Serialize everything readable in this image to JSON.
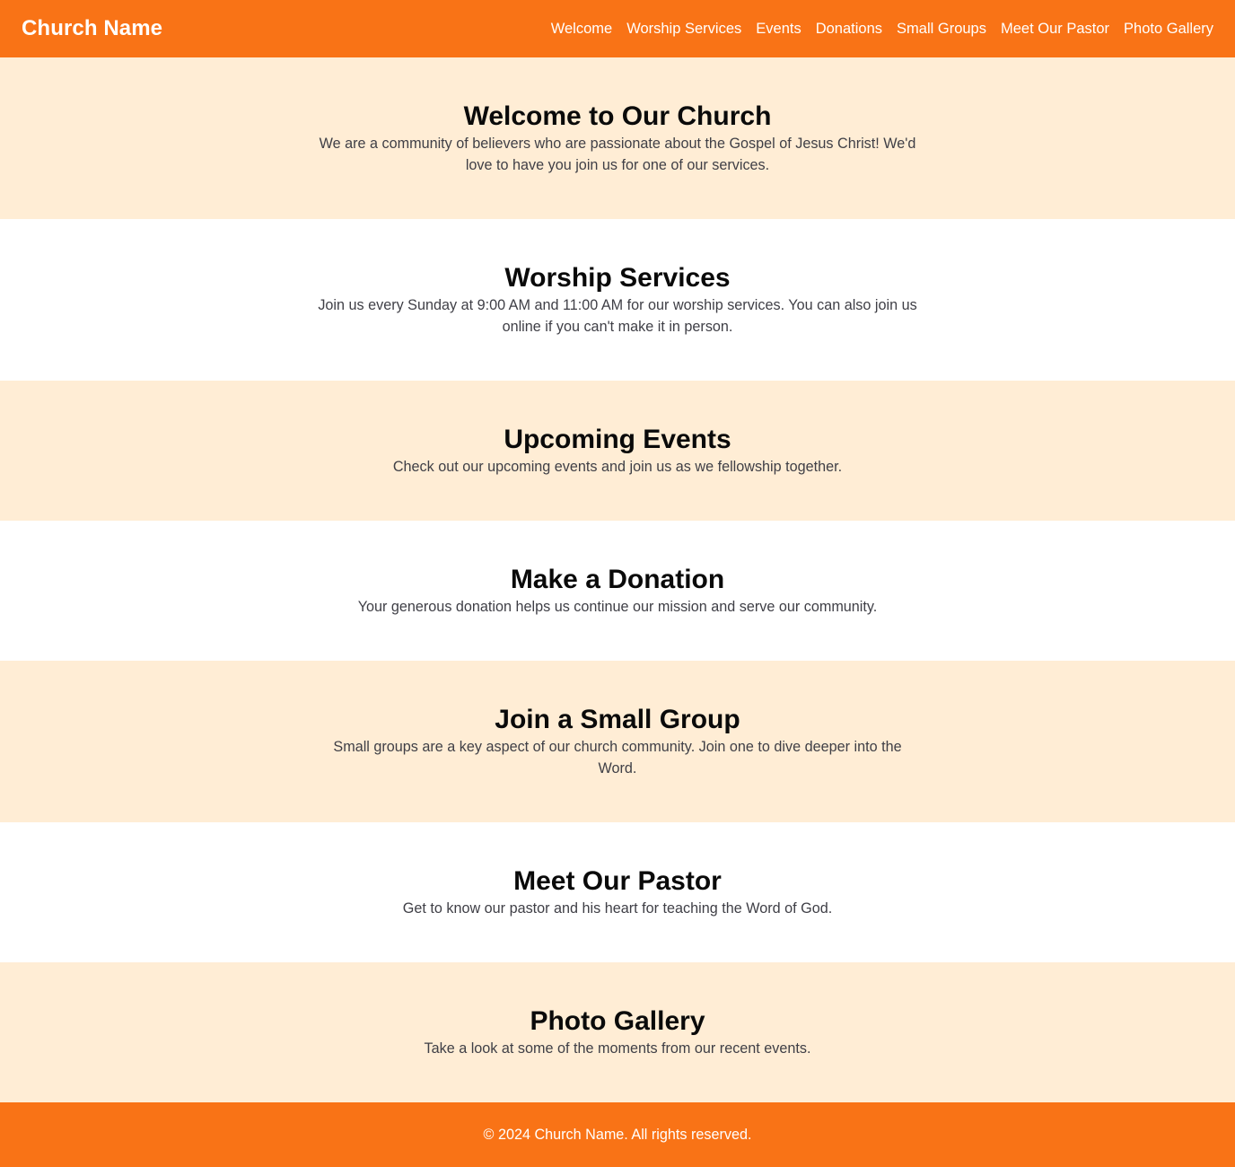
{
  "header": {
    "brand": "Church Name",
    "nav": [
      "Welcome",
      "Worship Services",
      "Events",
      "Donations",
      "Small Groups",
      "Meet Our Pastor",
      "Photo Gallery"
    ]
  },
  "sections": [
    {
      "title": "Welcome to Our Church",
      "text": "We are a community of believers who are passionate about the Gospel of Jesus Christ! We'd love to have you join us for one of our services."
    },
    {
      "title": "Worship Services",
      "text": "Join us every Sunday at 9:00 AM and 11:00 AM for our worship services. You can also join us online if you can't make it in person."
    },
    {
      "title": "Upcoming Events",
      "text": "Check out our upcoming events and join us as we fellowship together."
    },
    {
      "title": "Make a Donation",
      "text": "Your generous donation helps us continue our mission and serve our community."
    },
    {
      "title": "Join a Small Group",
      "text": "Small groups are a key aspect of our church community. Join one to dive deeper into the Word."
    },
    {
      "title": "Meet Our Pastor",
      "text": "Get to know our pastor and his heart for teaching the Word of God."
    },
    {
      "title": "Photo Gallery",
      "text": "Take a look at some of the moments from our recent events."
    }
  ],
  "footer": {
    "text": "© 2024 Church Name. All rights reserved."
  },
  "colors": {
    "primary": "#f97316",
    "alt_background": "#ffedd5"
  }
}
